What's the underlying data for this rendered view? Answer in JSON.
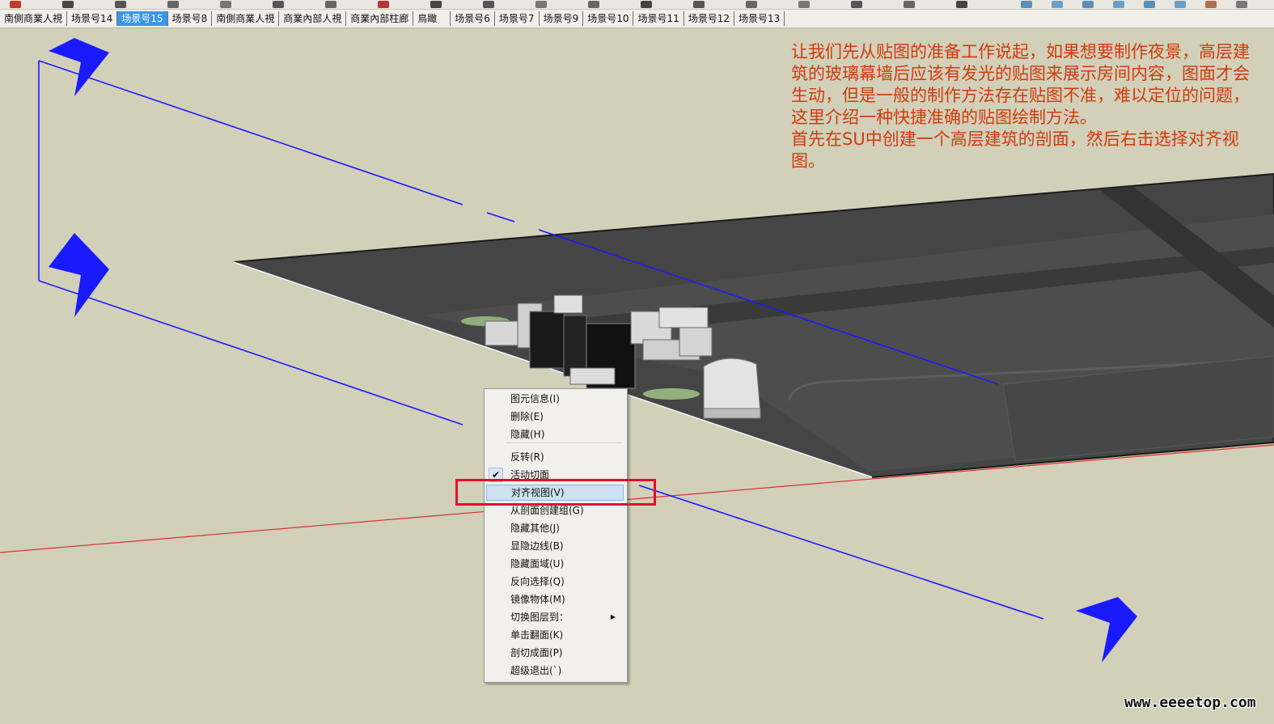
{
  "toolbar": {
    "icons": [
      "red-tool-icon",
      "pencil-icon",
      "arc-icon",
      "shape-icon",
      "push-pull-icon",
      "move-icon",
      "rotate-icon",
      "scale-icon",
      "offset-icon",
      "tape-icon",
      "dimension-icon",
      "text-icon",
      "axes-icon",
      "orbit-icon",
      "pan-icon",
      "zoom-icon",
      "walk-icon",
      "look-icon",
      "section-icon",
      "view-iso-icon",
      "view-top-icon",
      "view-front-icon",
      "view-right-icon",
      "view-back-icon",
      "view-left-icon",
      "layer-icon",
      "shadow-icon"
    ]
  },
  "scenes": {
    "tabs": [
      {
        "label": "南側商業人視",
        "active": false
      },
      {
        "label": "场景号14",
        "active": false
      },
      {
        "label": "场景号15",
        "active": true
      },
      {
        "label": "场景号8",
        "active": false
      },
      {
        "label": "南側商業人視",
        "active": false
      },
      {
        "label": "商業內部人視",
        "active": false
      },
      {
        "label": "商業內部柱廊",
        "active": false
      },
      {
        "label": "鳥瞰",
        "active": false
      },
      {
        "label": "场景号6",
        "active": false
      },
      {
        "label": "场景号7",
        "active": false
      },
      {
        "label": "场景号9",
        "active": false
      },
      {
        "label": "场景号10",
        "active": false
      },
      {
        "label": "场景号11",
        "active": false
      },
      {
        "label": "场景号12",
        "active": false
      },
      {
        "label": "场景号13",
        "active": false
      }
    ]
  },
  "annotation": {
    "paragraph1": "让我们先从贴图的准备工作说起，如果想要制作夜景，高层建筑的玻璃幕墙后应该有发光的贴图来展示房间内容，图面才会生动，但是一般的制作方法存在贴图不准，难以定位的问题，这里介绍一种快捷准确的贴图绘制方法。",
    "paragraph2": "首先在SU中创建一个高层建筑的剖面，然后右击选择对齐视图。",
    "color": "#d23a0e"
  },
  "context_menu": {
    "items": [
      {
        "label": "图元信息(I)"
      },
      {
        "label": "删除(E)"
      },
      {
        "label": "隐藏(H)"
      },
      {
        "label": "反转(R)"
      },
      {
        "label": "活动切面",
        "checked": true
      },
      {
        "label": "对齐视图(V)",
        "highlighted": true
      },
      {
        "label": "从剖面创建组(G)"
      },
      {
        "label": "隐藏其他(J)"
      },
      {
        "label": "显隐边线(B)"
      },
      {
        "label": "隐藏面域(U)"
      },
      {
        "label": "反向选择(Q)"
      },
      {
        "label": "镜像物体(M)"
      },
      {
        "label": "切换图层到：",
        "submenu": true
      },
      {
        "label": "单击翻面(K)"
      },
      {
        "label": "剖切成面(P)"
      },
      {
        "label": "超级退出(`)"
      }
    ]
  },
  "highlight_color": "#e3102a",
  "section_plane_color": "#1a1aff",
  "watermark": "www.eeeetop.com"
}
